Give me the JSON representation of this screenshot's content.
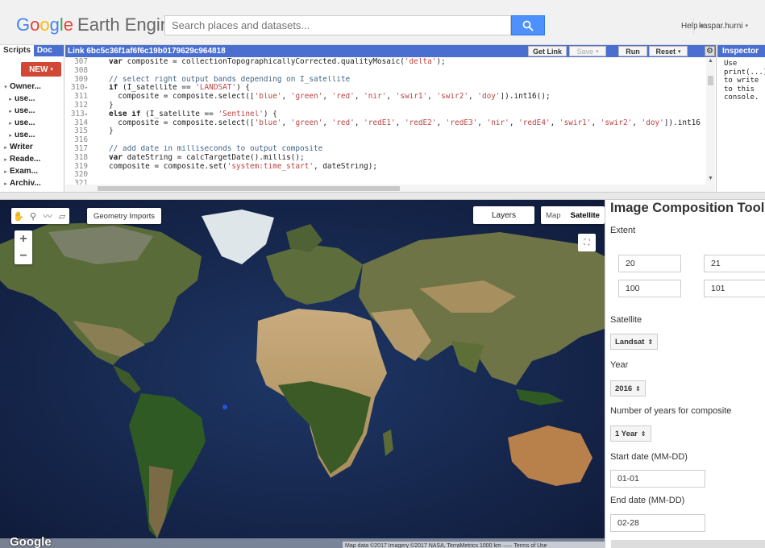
{
  "header": {
    "logo_google": "Google",
    "logo_earth_engine": "Earth Engine",
    "search_placeholder": "Search places and datasets...",
    "help_label": "Help",
    "user_label": "kaspar.hurni"
  },
  "left_panel": {
    "tab_scripts": "Scripts",
    "tab_docs": "Doc",
    "new_button": "NEW",
    "tree": [
      {
        "label": "Owner...",
        "bold": true,
        "arrow": "▾",
        "indent": 0
      },
      {
        "label": "use...",
        "bold": true,
        "arrow": "▸",
        "indent": 1
      },
      {
        "label": "use...",
        "bold": true,
        "arrow": "▸",
        "indent": 1
      },
      {
        "label": "use...",
        "bold": true,
        "arrow": "▸",
        "indent": 1
      },
      {
        "label": "use...",
        "bold": true,
        "arrow": "▸",
        "indent": 1
      },
      {
        "label": "Writer",
        "bold": true,
        "arrow": "▸",
        "indent": 0
      },
      {
        "label": "Reade...",
        "bold": true,
        "arrow": "▸",
        "indent": 0
      },
      {
        "label": "Exam...",
        "bold": true,
        "arrow": "▸",
        "indent": 0
      },
      {
        "label": "Archiv...",
        "bold": true,
        "arrow": "▸",
        "indent": 0
      }
    ]
  },
  "editor": {
    "title": "Link 6bc5c36f1af6f6c19b0179629c964818",
    "get_link": "Get Link",
    "save": "Save",
    "run": "Run",
    "reset": "Reset",
    "lines": [
      {
        "n": "307",
        "fold": "",
        "parts": [
          [
            "kw",
            "var "
          ],
          [
            "",
            "composite = collectionTopographicallyCorrected.qualityMosaic("
          ],
          [
            "str",
            "'delta'"
          ],
          [
            "",
            ");"
          ]
        ]
      },
      {
        "n": "308",
        "fold": "",
        "parts": []
      },
      {
        "n": "309",
        "fold": "",
        "parts": [
          [
            "cm",
            "// select right output bands depending on I_satellite"
          ]
        ]
      },
      {
        "n": "310",
        "fold": "▾",
        "parts": [
          [
            "kw",
            "if "
          ],
          [
            "",
            "(I_satellite == "
          ],
          [
            "str",
            "'LANDSAT'"
          ],
          [
            "",
            ") {"
          ]
        ]
      },
      {
        "n": "311",
        "fold": "",
        "parts": [
          [
            "",
            "  composite = composite.select(["
          ],
          [
            "str",
            "'blue'"
          ],
          [
            "",
            ", "
          ],
          [
            "str",
            "'green'"
          ],
          [
            "",
            ", "
          ],
          [
            "str",
            "'red'"
          ],
          [
            "",
            ", "
          ],
          [
            "str",
            "'nir'"
          ],
          [
            "",
            ", "
          ],
          [
            "str",
            "'swir1'"
          ],
          [
            "",
            ", "
          ],
          [
            "str",
            "'swir2'"
          ],
          [
            "",
            ", "
          ],
          [
            "str",
            "'doy'"
          ],
          [
            "",
            "]).int16();"
          ]
        ]
      },
      {
        "n": "312",
        "fold": "",
        "parts": [
          [
            "",
            "}"
          ]
        ]
      },
      {
        "n": "313",
        "fold": "▾",
        "parts": [
          [
            "kw",
            "else if "
          ],
          [
            "",
            "(I_satellite == "
          ],
          [
            "str",
            "'Sentinel'"
          ],
          [
            "",
            ") {"
          ]
        ]
      },
      {
        "n": "314",
        "fold": "",
        "parts": [
          [
            "",
            "  composite = composite.select(["
          ],
          [
            "str",
            "'blue'"
          ],
          [
            "",
            ", "
          ],
          [
            "str",
            "'green'"
          ],
          [
            "",
            ", "
          ],
          [
            "str",
            "'red'"
          ],
          [
            "",
            ", "
          ],
          [
            "str",
            "'redE1'"
          ],
          [
            "",
            ", "
          ],
          [
            "str",
            "'redE2'"
          ],
          [
            "",
            ", "
          ],
          [
            "str",
            "'redE3'"
          ],
          [
            "",
            ", "
          ],
          [
            "str",
            "'nir'"
          ],
          [
            "",
            ", "
          ],
          [
            "str",
            "'redE4'"
          ],
          [
            "",
            ", "
          ],
          [
            "str",
            "'swir1'"
          ],
          [
            "",
            ", "
          ],
          [
            "str",
            "'swir2'"
          ],
          [
            "",
            ", "
          ],
          [
            "str",
            "'doy'"
          ],
          [
            "",
            "]).int16"
          ]
        ]
      },
      {
        "n": "315",
        "fold": "",
        "parts": [
          [
            "",
            "}"
          ]
        ]
      },
      {
        "n": "316",
        "fold": "",
        "parts": []
      },
      {
        "n": "317",
        "fold": "",
        "parts": [
          [
            "cm",
            "// add date in milliseconds to output composite"
          ]
        ]
      },
      {
        "n": "318",
        "fold": "",
        "parts": [
          [
            "kw",
            "var "
          ],
          [
            "",
            "dateString = calcTargetDate().millis();"
          ]
        ]
      },
      {
        "n": "319",
        "fold": "",
        "parts": [
          [
            "",
            "composite = composite.set("
          ],
          [
            "str",
            "'system:time_start'"
          ],
          [
            "",
            ", dateString);"
          ]
        ]
      },
      {
        "n": "320",
        "fold": "",
        "parts": []
      },
      {
        "n": "321",
        "fold": "",
        "parts": []
      }
    ]
  },
  "inspector": {
    "tab": "Inspector",
    "text": "Use\nprint(...)\nto write\nto this\nconsole."
  },
  "map": {
    "geometry_imports": "Geometry Imports",
    "layers": "Layers",
    "map_type": "Map",
    "satellite_type": "Satellite",
    "google_logo": "Google",
    "attribution": "Map data ©2017 Imagery ©2017 NASA, TerraMetrics   1000 km ⸺   Terms of Use"
  },
  "tool": {
    "title": "Image Composition Tool",
    "extent_label": "Extent",
    "extent_values": [
      "20",
      "21",
      "100",
      "101"
    ],
    "satellite_label": "Satellite",
    "satellite_value": "Landsat",
    "year_label": "Year",
    "year_value": "2016",
    "nyears_label": "Number of years for composite",
    "nyears_value": "1 Year",
    "start_label": "Start date (MM-DD)",
    "start_value": "01-01",
    "end_label": "End date (MM-DD)",
    "end_value": "02-28"
  }
}
